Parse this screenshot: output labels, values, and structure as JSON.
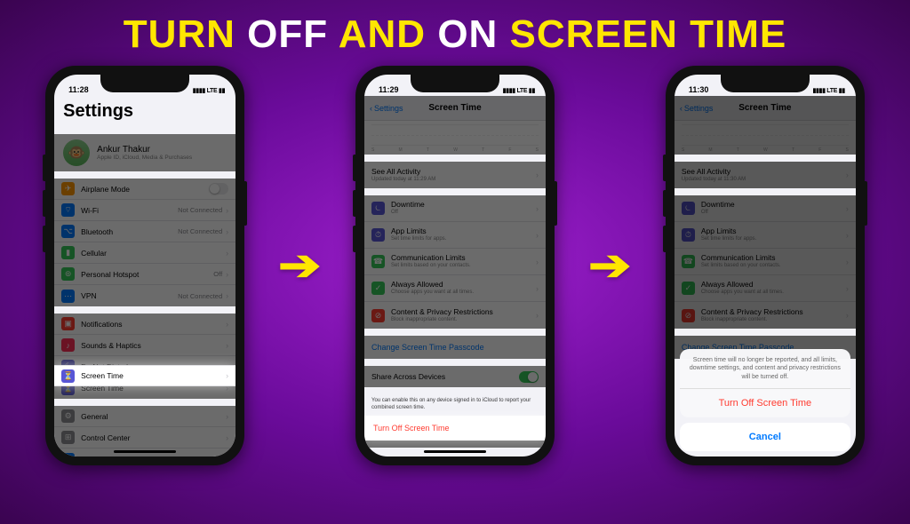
{
  "headline": {
    "w1": "TURN",
    "w2": "OFF",
    "w3": "AND",
    "w4": "ON",
    "w5": "SCREEN TIME"
  },
  "phone1": {
    "time": "11:28",
    "carrier": "▮▮▮▮ LTE ▮▮",
    "title": "Settings",
    "profile_name": "Ankur Thakur",
    "profile_sub": "Apple ID, iCloud, Media & Purchases",
    "rows": {
      "airplane": "Airplane Mode",
      "wifi": "Wi-Fi",
      "wifi_detail": "Not Connected",
      "bluetooth": "Bluetooth",
      "bt_detail": "Not Connected",
      "cellular": "Cellular",
      "hotspot": "Personal Hotspot",
      "hotspot_detail": "Off",
      "vpn": "VPN",
      "vpn_detail": "Not Connected",
      "notifications": "Notifications",
      "sounds": "Sounds & Haptics",
      "dnd": "Do Not Disturb",
      "screentime": "Screen Time",
      "general": "General",
      "control": "Control Center",
      "display": "Display & Brightness"
    }
  },
  "phone2": {
    "time": "11:29",
    "back": "Settings",
    "title": "Screen Time",
    "see_all": "See All Activity",
    "updated": "Updated today at 11:29 AM",
    "days": [
      "S",
      "M",
      "T",
      "W",
      "T",
      "F",
      "S"
    ],
    "rows": {
      "downtime": "Downtime",
      "downtime_sub": "Off",
      "applimits": "App Limits",
      "applimits_sub": "Set time limits for apps.",
      "comm": "Communication Limits",
      "comm_sub": "Set limits based on your contacts.",
      "always": "Always Allowed",
      "always_sub": "Choose apps you want at all times.",
      "content": "Content & Privacy Restrictions",
      "content_sub": "Block inappropriate content."
    },
    "change_passcode": "Change Screen Time Passcode",
    "share": "Share Across Devices",
    "share_footer": "You can enable this on any device signed in to iCloud to report your combined screen time.",
    "turn_off": "Turn Off Screen Time"
  },
  "phone3": {
    "time": "11:30",
    "back": "Settings",
    "title": "Screen Time",
    "see_all": "See All Activity",
    "updated": "Updated today at 11:30 AM",
    "rows": {
      "downtime": "Downtime",
      "downtime_sub": "Off",
      "applimits": "App Limits",
      "applimits_sub": "Set time limits for apps.",
      "comm": "Communication Limits",
      "comm_sub": "Set limits based on your contacts.",
      "always": "Always Allowed",
      "always_sub": "Choose apps you want at all times.",
      "content": "Content & Privacy Restrictions",
      "content_sub": "Block inappropriate content."
    },
    "change_passcode": "Change Screen Time Passcode",
    "sheet_msg": "Screen time will no longer be reported, and all limits, downtime settings, and content and privacy restrictions will be turned off.",
    "sheet_confirm": "Turn Off Screen Time",
    "sheet_cancel": "Cancel"
  },
  "icons": {
    "airplane": {
      "bg": "#ff9500",
      "glyph": "✈"
    },
    "wifi": {
      "bg": "#007aff",
      "glyph": "⌔"
    },
    "bluetooth": {
      "bg": "#007aff",
      "glyph": "⌥"
    },
    "cellular": {
      "bg": "#34c759",
      "glyph": "▮"
    },
    "hotspot": {
      "bg": "#34c759",
      "glyph": "⊚"
    },
    "vpn": {
      "bg": "#007aff",
      "glyph": "⋯"
    },
    "notifications": {
      "bg": "#ff3b30",
      "glyph": "▣"
    },
    "sounds": {
      "bg": "#ff2d55",
      "glyph": "♪"
    },
    "dnd": {
      "bg": "#5856d6",
      "glyph": "☾"
    },
    "screentime": {
      "bg": "#5856d6",
      "glyph": "⏳"
    },
    "general": {
      "bg": "#8e8e93",
      "glyph": "⚙"
    },
    "control": {
      "bg": "#8e8e93",
      "glyph": "⊞"
    },
    "display": {
      "bg": "#007aff",
      "glyph": "A"
    },
    "downtime": {
      "bg": "#5856d6",
      "glyph": "⏾"
    },
    "applimits": {
      "bg": "#5856d6",
      "glyph": "⏱"
    },
    "comm": {
      "bg": "#34c759",
      "glyph": "☎"
    },
    "always": {
      "bg": "#34c759",
      "glyph": "✓"
    },
    "content": {
      "bg": "#ff3b30",
      "glyph": "⊘"
    }
  }
}
